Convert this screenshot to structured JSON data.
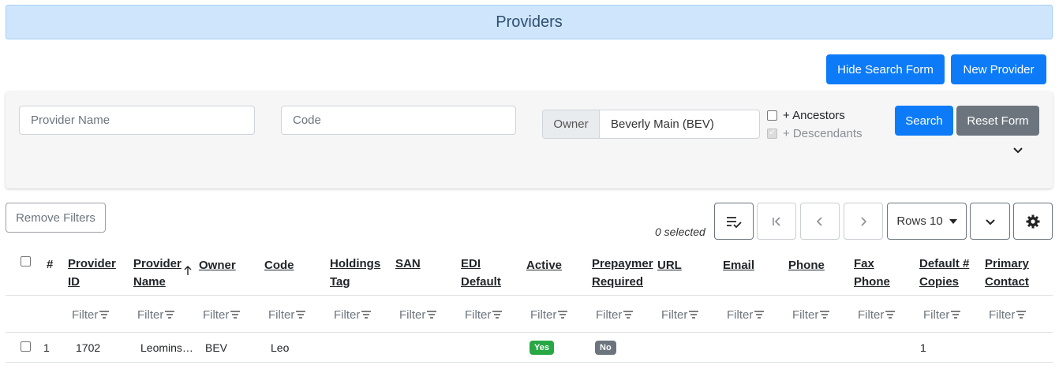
{
  "page": {
    "title": "Providers"
  },
  "top_buttons": {
    "hide_search": "Hide Search Form",
    "new_provider": "New Provider"
  },
  "search": {
    "provider_name_placeholder": "Provider Name",
    "code_placeholder": "Code",
    "owner_label": "Owner",
    "owner_value": "Beverly Main (BEV)",
    "ancestors_label": "+ Ancestors",
    "ancestors_checked": false,
    "descendants_label": "+ Descendants",
    "descendants_checked": true,
    "search_label": "Search",
    "reset_label": "Reset Form"
  },
  "toolbar": {
    "remove_filters": "Remove Filters",
    "selected_text": "0 selected",
    "rows_label": "Rows 10"
  },
  "table": {
    "headers": {
      "num": "#",
      "provider_id": [
        "Provider",
        "ID"
      ],
      "provider_name": [
        "Provider",
        "Name"
      ],
      "owner": "Owner",
      "code": "Code",
      "holdings_tag": [
        "Holdings",
        "Tag"
      ],
      "san": "SAN",
      "edi_default": [
        "EDI",
        "Default"
      ],
      "active": "Active",
      "prepayment": [
        "Prepaymer",
        "Required"
      ],
      "url": "URL",
      "email": "Email",
      "phone": "Phone",
      "fax_phone": [
        "Fax",
        "Phone"
      ],
      "default_copies": [
        "Default #",
        "Copies"
      ],
      "primary_contact": [
        "Primary",
        "Contact"
      ]
    },
    "filter_label": "Filter",
    "rows": [
      {
        "num": "1",
        "provider_id": "1702",
        "provider_name": "Leomins…",
        "owner": "BEV",
        "code": "Leo",
        "active": "Yes",
        "prepayment": "No",
        "default_copies": "1"
      }
    ]
  },
  "colors": {
    "primary": "#0d7bf7",
    "secondary": "#6c757d",
    "success": "#28a745",
    "header_bg": "#cfe5fb"
  }
}
